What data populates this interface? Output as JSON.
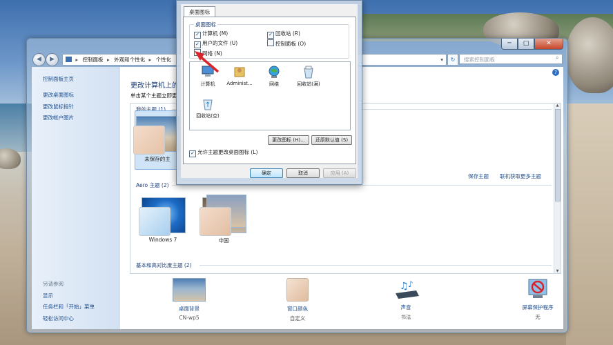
{
  "window": {
    "breadcrumbs": [
      "控制面板",
      "外观和个性化",
      "个性化"
    ],
    "search_placeholder": "搜索控制面板",
    "caption": {
      "minimize": "─",
      "maximize": "□",
      "close": "✕"
    }
  },
  "sidebar": {
    "home": "控制面板主页",
    "links": [
      "更改桌面图标",
      "更改鼠标指针",
      "更改帐户图片"
    ],
    "see_also_title": "另请参阅",
    "see_also": [
      "显示",
      "任务栏和「开始」菜单",
      "轻松访问中心"
    ]
  },
  "main": {
    "heading": "更改计算机上的",
    "subtitle": "单击某个主题立即更",
    "my_themes": {
      "title": "我的主题 (1)",
      "items": [
        {
          "name": "未保存的主"
        }
      ]
    },
    "save_theme_link": "保存主题",
    "online_themes_link": "联机获取更多主题",
    "aero_themes": {
      "title": "Aero 主题 (2)",
      "items": [
        {
          "name": "Windows 7"
        },
        {
          "name": "中国"
        }
      ]
    },
    "basic_themes_title": "基本和高对比度主题 (2)"
  },
  "bottom": [
    {
      "label": "桌面背景",
      "value": "CN-wp5"
    },
    {
      "label": "窗口颜色",
      "value": "自定义"
    },
    {
      "label": "声音",
      "value": "书法"
    },
    {
      "label": "屏幕保护程序",
      "value": "无"
    }
  ],
  "dialog": {
    "tab": "桌面图标",
    "group_title": "桌面图标",
    "checkboxes": [
      {
        "label": "计算机 (M)",
        "checked": true
      },
      {
        "label": "回收站 (R)",
        "checked": true
      },
      {
        "label": "用户的文件 (U)",
        "checked": true
      },
      {
        "label": "控制面板 (O)",
        "checked": false
      },
      {
        "label": "网络 (N)",
        "checked": false
      }
    ],
    "icons": [
      "计算机",
      "Administ...",
      "网络",
      "回收站(满)",
      "回收站(空)"
    ],
    "change_icon_button": "更改图标 (H)...",
    "restore_default_button": "还原默认值 (S)",
    "allow_themes_label": "允许主题更改桌面图标 (L)",
    "allow_themes_checked": true,
    "ok_button": "确定",
    "cancel_button": "取消",
    "apply_button": "应用 (A)"
  },
  "colors": {
    "link": "#1e4f91",
    "heading": "#1e3f79",
    "annotation_arrow": "#d8242a"
  }
}
